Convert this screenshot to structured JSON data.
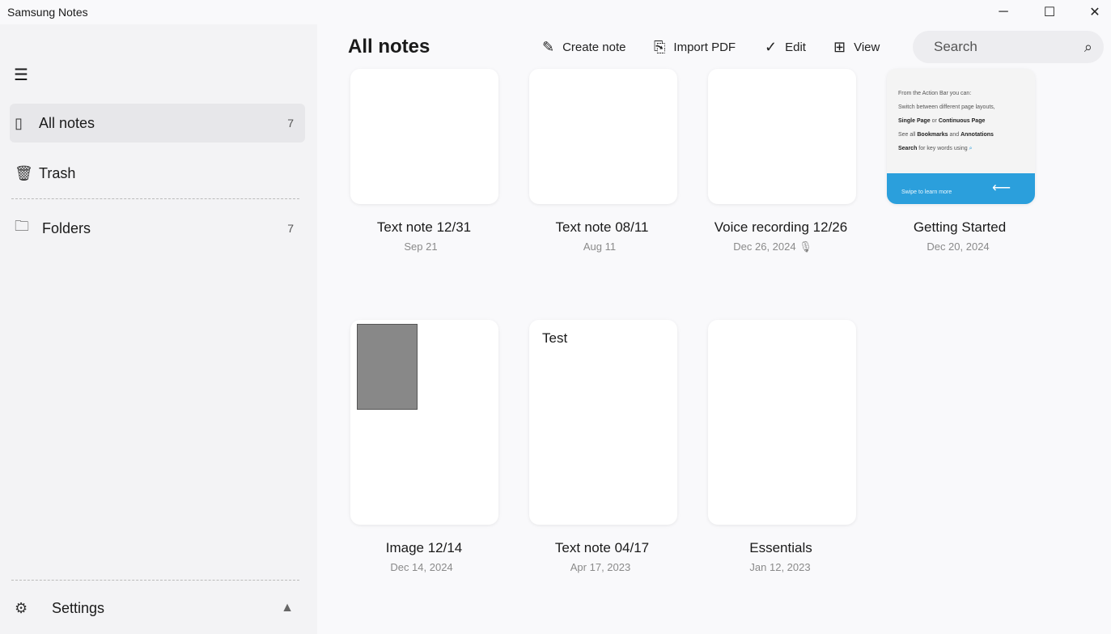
{
  "app": {
    "title": "Samsung Notes",
    "minimize": "─",
    "maximize": "☐",
    "close": "✕"
  },
  "sidebar": {
    "menu_icon": "☰",
    "items": [
      {
        "label": "All notes",
        "count": "7"
      },
      {
        "label": "Trash"
      },
      {
        "label": "Folders",
        "count": "7"
      }
    ],
    "settings": "Settings",
    "warning": "▲"
  },
  "header": {
    "title": "All notes",
    "create": "Create note",
    "import": "Import PDF",
    "edit": "Edit",
    "view": "View",
    "search_placeholder": "Search"
  },
  "notes": [
    {
      "title": "Text note 12/31",
      "date": "Sep 21"
    },
    {
      "title": "Text note 08/11",
      "date": "Aug 11"
    },
    {
      "title": "Voice recording 12/26",
      "date": "Dec 26, 2024"
    },
    {
      "title": "Getting Started",
      "date": "Dec 20, 2024"
    },
    {
      "title": "Image 12/14",
      "date": "Dec 14, 2024"
    },
    {
      "title": "Text note 04/17",
      "date": "Apr 17, 2023",
      "preview": "Test"
    },
    {
      "title": "Essentials",
      "date": "Jan 12, 2023"
    }
  ],
  "getting_started_preview": {
    "l1": "From the Action Bar you can:",
    "l2": "Switch between different page layouts,",
    "l3a": "Single Page",
    "l3b": " or ",
    "l3c": "Continuous Page",
    "l4a": "See all ",
    "l4b": "Bookmarks",
    "l4c": " and ",
    "l4d": "Annotations",
    "l5a": "Search",
    "l5b": " for key words using",
    "bar": "Swipe to learn more"
  }
}
